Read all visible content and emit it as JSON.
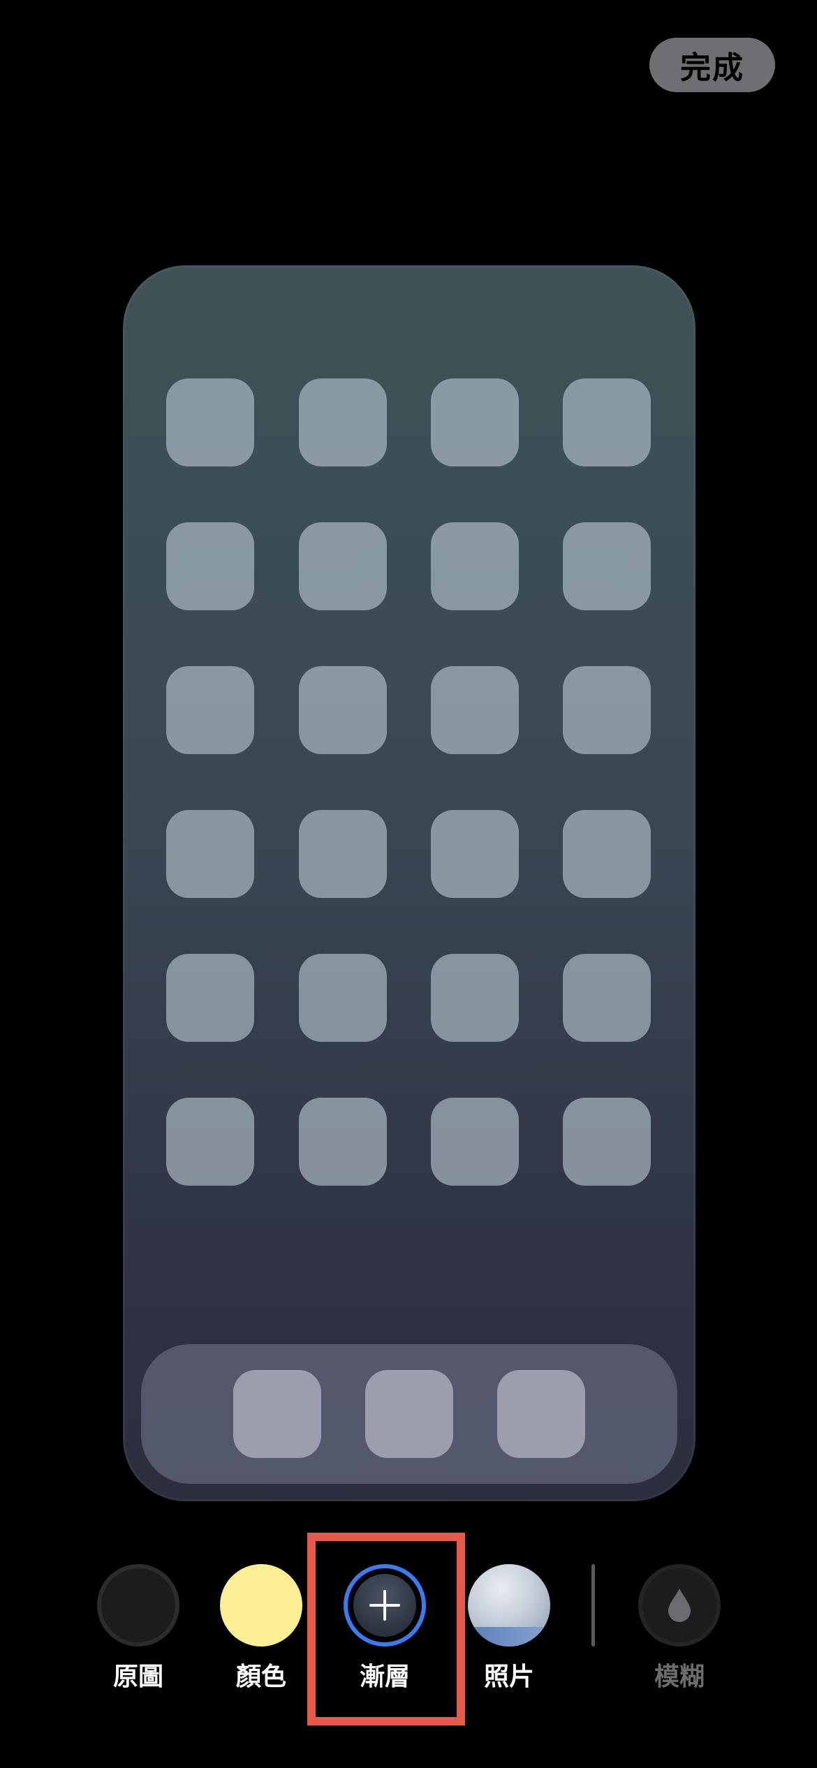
{
  "header": {
    "done_label": "完成"
  },
  "options": [
    {
      "id": "original",
      "label": "原圖",
      "icon": "dark-circle-swatch"
    },
    {
      "id": "color",
      "label": "顏色",
      "icon": "yellow-circle-swatch"
    },
    {
      "id": "gradient",
      "label": "漸層",
      "icon": "plus-icon",
      "selected": true
    },
    {
      "id": "photo",
      "label": "照片",
      "icon": "photo-thumbnail"
    },
    {
      "id": "blur",
      "label": "模糊",
      "icon": "droplet-icon",
      "disabled": true
    }
  ],
  "colors": {
    "selected_ring": "#3a7bf0",
    "highlight": "#e55a4b",
    "color_swatch": "#fbef96"
  }
}
